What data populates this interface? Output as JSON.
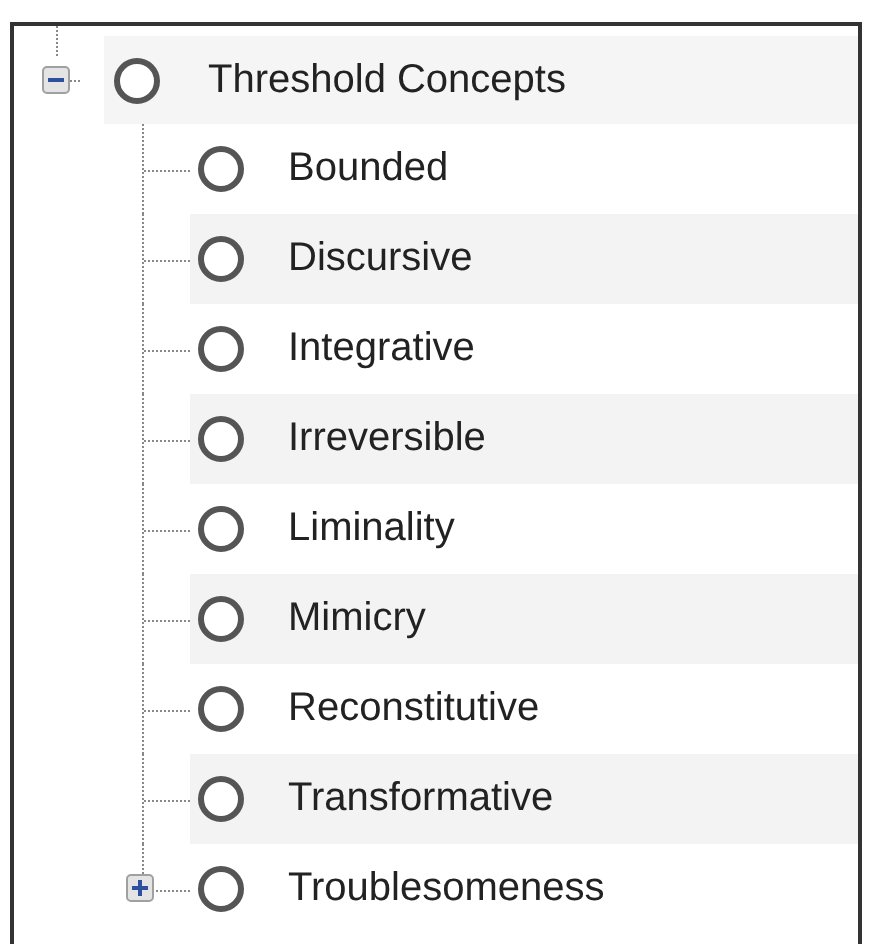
{
  "tree": {
    "label": "Threshold Concepts",
    "kind": "branch",
    "expanded": true,
    "selected": false,
    "children": [
      {
        "label": "Bounded",
        "kind": "leaf",
        "selected": false
      },
      {
        "label": "Discursive",
        "kind": "leaf",
        "selected": false
      },
      {
        "label": "Integrative",
        "kind": "leaf",
        "selected": false
      },
      {
        "label": "Irreversible",
        "kind": "leaf",
        "selected": false
      },
      {
        "label": "Liminality",
        "kind": "leaf",
        "selected": false
      },
      {
        "label": "Mimicry",
        "kind": "leaf",
        "selected": false
      },
      {
        "label": "Reconstitutive",
        "kind": "leaf",
        "selected": false
      },
      {
        "label": "Transformative",
        "kind": "leaf",
        "selected": false
      },
      {
        "label": "Troublesomeness",
        "kind": "branch",
        "expanded": false,
        "selected": false
      }
    ]
  }
}
